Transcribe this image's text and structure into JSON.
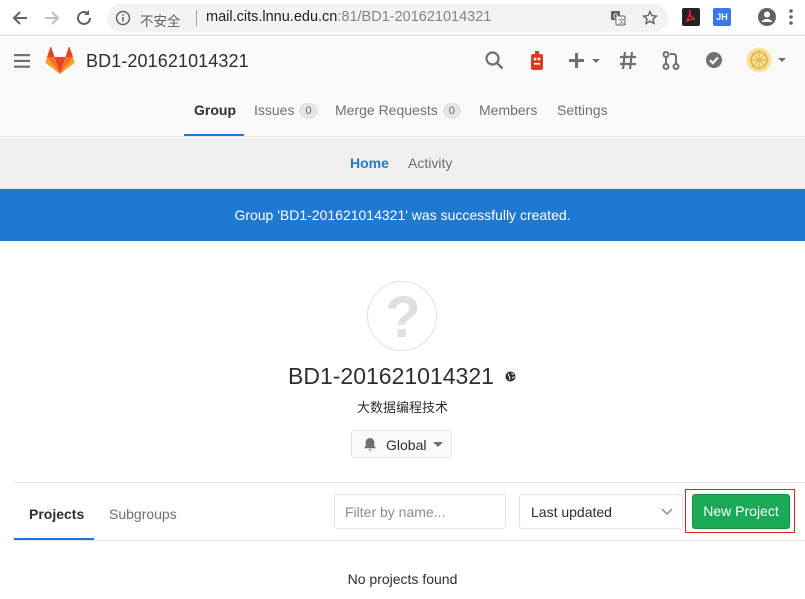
{
  "browser": {
    "insecure_label": "不安全",
    "url_host": "mail.cits.lnnu.edu.cn",
    "url_rest": ":81/BD1-201621014321",
    "icons": [
      "back-arrow-icon",
      "forward-arrow-icon",
      "reload-icon",
      "info-icon",
      "translate-icon",
      "star-icon",
      "pdf-extension-icon",
      "jh-extension-icon",
      "account-icon",
      "kebab-menu-icon"
    ],
    "jh_ext_label": "JH"
  },
  "header": {
    "group_name": "BD1-201621014321",
    "icons": [
      "search-icon",
      "todo-robot-icon",
      "plus-icon",
      "hashtag-icon",
      "merge-request-icon",
      "check-circle-icon",
      "user-avatar-icon"
    ]
  },
  "group_nav": {
    "tabs": [
      {
        "label": "Group"
      },
      {
        "label": "Issues",
        "count": "0"
      },
      {
        "label": "Merge Requests",
        "count": "0"
      },
      {
        "label": "Members"
      },
      {
        "label": "Settings"
      }
    ],
    "active": "Group"
  },
  "sub_nav": {
    "tabs": [
      {
        "label": "Home"
      },
      {
        "label": "Activity"
      }
    ],
    "active": "Home"
  },
  "flash": {
    "message": "Group 'BD1-201621014321' was successfully created."
  },
  "group": {
    "title": "BD1-201621014321",
    "description": "大数据编程技术",
    "avatar_glyph": "?",
    "notification_level": "Global"
  },
  "projects": {
    "tabs": [
      {
        "label": "Projects"
      },
      {
        "label": "Subgroups"
      }
    ],
    "active": "Projects",
    "filter_placeholder": "Filter by name...",
    "filter_value": "",
    "sort_selected": "Last updated",
    "new_project_label": "New Project",
    "empty_message": "No projects found"
  },
  "colors": {
    "accent": "#1f78d1",
    "success": "#1aaa55",
    "highlight": "#d9231e"
  }
}
